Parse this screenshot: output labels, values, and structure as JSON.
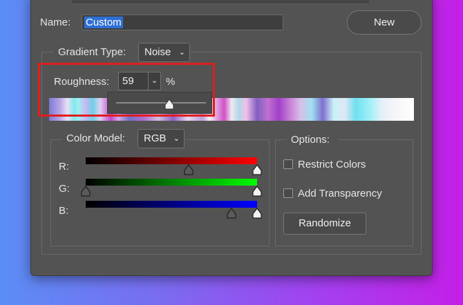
{
  "dialog": {
    "name_label": "Name:",
    "name_value": "Custom",
    "new_button": "New"
  },
  "gradient": {
    "type_label": "Gradient Type:",
    "type_value": "Noise",
    "roughness_label": "Roughness:",
    "roughness_value": "59",
    "roughness_unit": "%",
    "roughness_percent": 59
  },
  "color_model": {
    "label": "Color Model:",
    "value": "RGB",
    "channels": [
      {
        "label": "R:",
        "min": 0.6,
        "max": 1.0,
        "color": "#ff0000"
      },
      {
        "label": "G:",
        "min": 0.0,
        "max": 1.0,
        "color": "#00ff00"
      },
      {
        "label": "B:",
        "min": 0.85,
        "max": 1.0,
        "color": "#0000ff"
      }
    ]
  },
  "options": {
    "label": "Options:",
    "restrict_colors": "Restrict Colors",
    "add_transparency": "Add Transparency",
    "randomize_button": "Randomize"
  },
  "icons": {
    "dropdown": "chevron-down-icon",
    "slider_thumb": "triangle-thumb-icon"
  }
}
